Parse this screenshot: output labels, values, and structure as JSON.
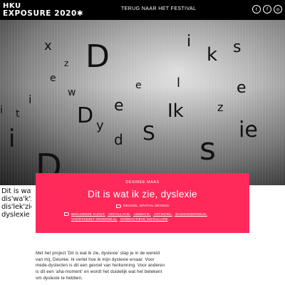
{
  "header": {
    "logo_top": "HKU",
    "logo_name": "EXPOSURE 2020✱",
    "nav_back": "TERUG NAAR HET FESTIVAL",
    "social": [
      {
        "icon": "twitter-icon",
        "glyph": "t"
      },
      {
        "icon": "facebook-icon",
        "glyph": "f"
      },
      {
        "icon": "instagram-icon",
        "glyph": "◎"
      }
    ]
  },
  "hero": {
    "letters": [
      "D",
      "i",
      "s",
      "l",
      "e",
      "k",
      "ie",
      "s",
      "Ik",
      "z",
      "D",
      "i",
      "e",
      "y",
      "d",
      "S",
      "x",
      "e",
      "i",
      "w",
      "D",
      "i",
      "t",
      "z",
      "e"
    ]
  },
  "project": {
    "author": "DÉSIRÉE MAAS",
    "title": "Dit is wat ik zie, dyslexie",
    "categories": "DESIGN, SPATIAL DESIGN",
    "tags": [
      "BEELDENDE KUNST,",
      "INSTALLATIE,",
      "ANIMATIE,",
      "ARTWORK,",
      "BASISONDERWIJS,",
      "VOORTGEZET ONDERWIJS,",
      "INTERACTIEVE INSTALLATIE"
    ]
  },
  "thumbnail": {
    "lines": [
      "Dit is wat ik zie",
      "dis'wa'k'zie",
      "dis'lek'zie",
      "dyslexie"
    ]
  },
  "description": {
    "lines": [
      "Met het project 'Dit is wat ik zie, dyslexie' stap je in de wereld",
      "van mij, Désirée. Ik vertel hoe ik mijn dyslexie ervaar. Voor",
      "mede-dyslecten is dit een gevoel van herkenning. Voor anderen",
      "is dit een 'aha-moment' en wordt het duidelijk wat het betekent",
      "om dyslexie te hebben."
    ]
  },
  "colors": {
    "accent": "#ff2a5a",
    "header_bg": "#000000"
  }
}
